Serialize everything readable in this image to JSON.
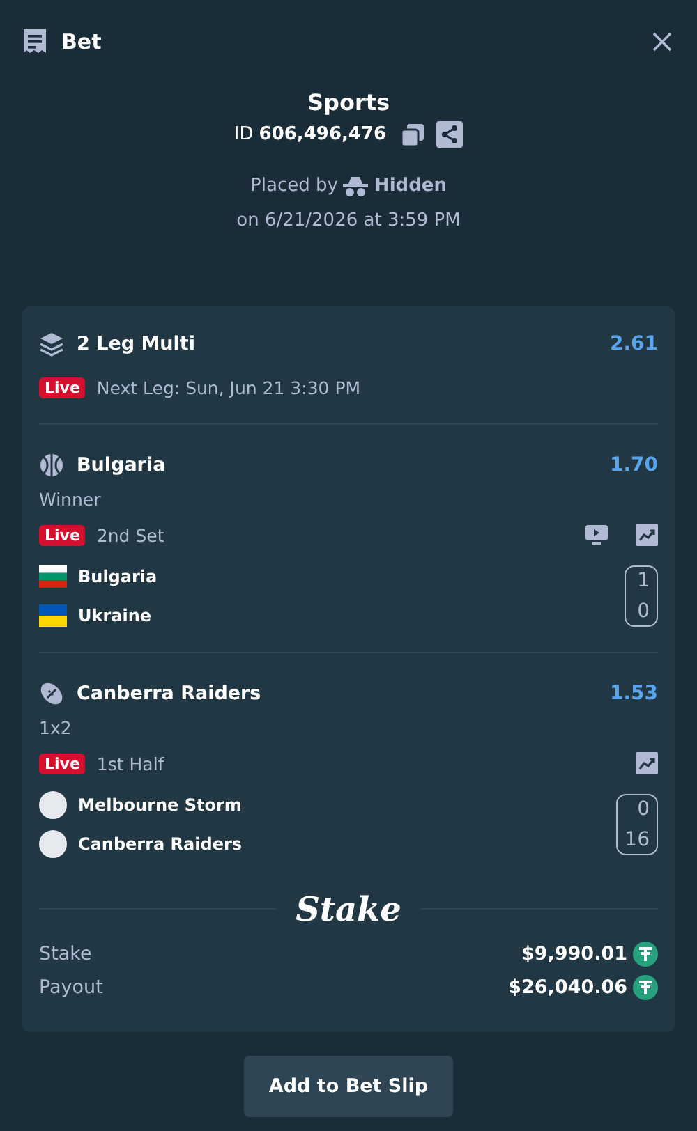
{
  "header": {
    "title": "Bet"
  },
  "summary": {
    "title": "Sports",
    "id_label": "ID",
    "id_value": "606,496,476",
    "placed_by_label": "Placed by",
    "placed_by_user": "Hidden",
    "placed_on": "on 6/21/2026 at 3:59 PM"
  },
  "multi": {
    "title": "2 Leg Multi",
    "odds": "2.61",
    "live_badge": "Live",
    "next_leg": "Next Leg: Sun, Jun 21 3:30 PM"
  },
  "legs": [
    {
      "kind": "tennis",
      "title": "Bulgaria",
      "odds": "1.70",
      "market": "Winner",
      "live_badge": "Live",
      "period": "2nd Set",
      "stream": true,
      "stats": true,
      "teams": [
        {
          "kind": "flag_bulgaria",
          "name": "Bulgaria",
          "score": "1"
        },
        {
          "kind": "flag_ukraine",
          "name": "Ukraine",
          "score": "0"
        }
      ]
    },
    {
      "kind": "rugby",
      "title": "Canberra Raiders",
      "odds": "1.53",
      "market": "1x2",
      "live_badge": "Live",
      "period": "1st Half",
      "stream": false,
      "stats": true,
      "teams": [
        {
          "kind": "crest",
          "name": "Melbourne Storm",
          "score": "0"
        },
        {
          "kind": "crest",
          "name": "Canberra Raiders",
          "score": "16"
        }
      ]
    }
  ],
  "brand": {
    "logo": "Stake"
  },
  "totals": [
    {
      "label": "Stake",
      "amount": "$9,990.01"
    },
    {
      "label": "Payout",
      "amount": "$26,040.06"
    }
  ],
  "footer": {
    "button": "Add to Bet Slip"
  }
}
